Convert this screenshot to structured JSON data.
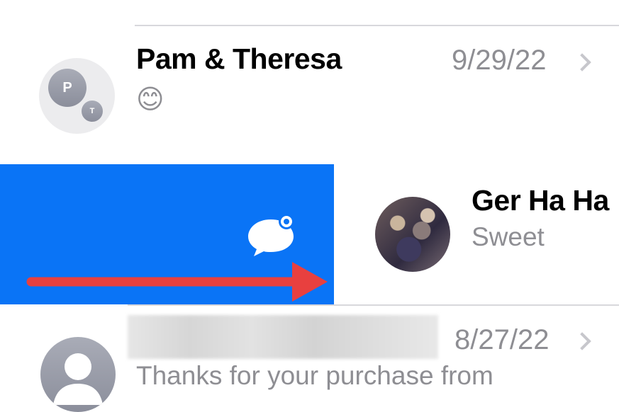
{
  "conversations": [
    {
      "name": "Pam & Theresa",
      "date": "9/29/22",
      "preview": "😊",
      "avatar_initials": [
        "P",
        "T"
      ]
    },
    {
      "name": "Ger Ha Ha",
      "preview": "Sweet"
    },
    {
      "name": "",
      "date": "8/27/22",
      "preview": "Thanks for your purchase from"
    }
  ],
  "swipe_action": {
    "icon": "message-unread-icon",
    "color": "#0a74f6"
  },
  "annotation": {
    "icon": "red-arrow-right-icon",
    "color": "#e8403f"
  }
}
